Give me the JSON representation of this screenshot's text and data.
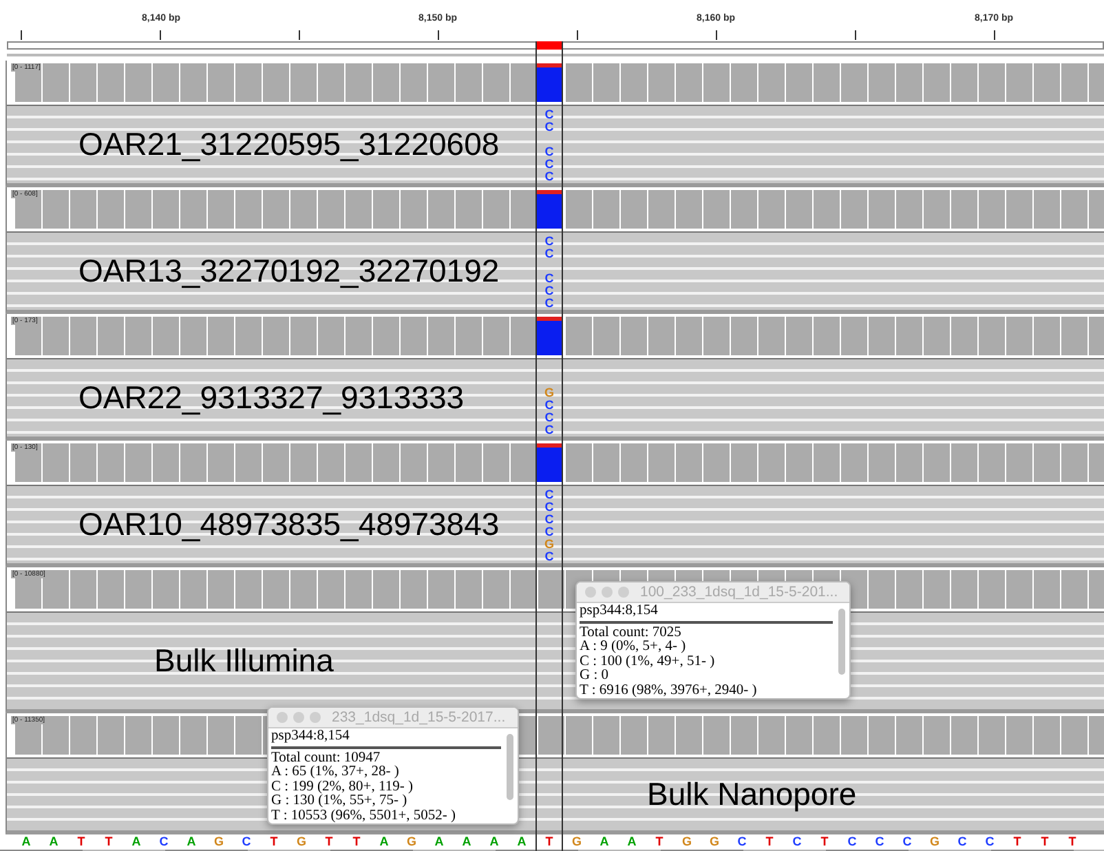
{
  "ruler": {
    "ticks": [
      "8,140 bp",
      "8,150 bp",
      "8,160 bp",
      "8,170 bp"
    ]
  },
  "tracks": [
    {
      "range": "[0 - 1117]",
      "label": "OAR21_31220595_31220608",
      "mismatches": [
        {
          "kind": "base",
          "base": "C",
          "color": "#1e3cff"
        },
        {
          "kind": "base",
          "base": "C",
          "color": "#1e3cff"
        },
        {
          "kind": "gap"
        },
        {
          "kind": "base",
          "base": "C",
          "color": "#1e3cff"
        },
        {
          "kind": "base",
          "base": "C",
          "color": "#1e3cff"
        },
        {
          "kind": "base",
          "base": "C",
          "color": "#1e3cff"
        }
      ]
    },
    {
      "range": "[0 - 608]",
      "label": "OAR13_32270192_32270192",
      "mismatches": [
        {
          "kind": "base",
          "base": "C",
          "color": "#1e3cff"
        },
        {
          "kind": "base",
          "base": "C",
          "color": "#1e3cff"
        },
        {
          "kind": "gap"
        },
        {
          "kind": "base",
          "base": "C",
          "color": "#1e3cff"
        },
        {
          "kind": "base",
          "base": "C",
          "color": "#1e3cff"
        },
        {
          "kind": "base",
          "base": "C",
          "color": "#1e3cff"
        }
      ]
    },
    {
      "range": "[0 - 173]",
      "label": "OAR22_9313327_9313333",
      "mismatches": [
        {
          "kind": "gap"
        },
        {
          "kind": "gap"
        },
        {
          "kind": "base",
          "base": "G",
          "color": "#d1861a"
        },
        {
          "kind": "base",
          "base": "C",
          "color": "#1e3cff"
        },
        {
          "kind": "base",
          "base": "C",
          "color": "#1e3cff"
        },
        {
          "kind": "base",
          "base": "C",
          "color": "#1e3cff"
        }
      ]
    },
    {
      "range": "[0 - 130]",
      "label": "OAR10_48973835_48973843",
      "mismatches": [
        {
          "kind": "base",
          "base": "C",
          "color": "#1e3cff"
        },
        {
          "kind": "base",
          "base": "C",
          "color": "#1e3cff"
        },
        {
          "kind": "base",
          "base": "C",
          "color": "#1e3cff"
        },
        {
          "kind": "base",
          "base": "C",
          "color": "#1e3cff"
        },
        {
          "kind": "base",
          "base": "G",
          "color": "#d1861a"
        },
        {
          "kind": "base",
          "base": "C",
          "color": "#1e3cff"
        }
      ]
    },
    {
      "range": "[0 - 10880]",
      "label": "Bulk Illumina"
    },
    {
      "range": "[0 - 11350]",
      "label": "Bulk Nanopore"
    }
  ],
  "popups": [
    {
      "title": "100_233_1dsq_1d_15-5-201...",
      "locus": "psp344:8,154",
      "lines": [
        "Total count: 7025",
        "A : 9 (0%, 5+, 4- )",
        "C : 100 (1%, 49+, 51- )",
        "G : 0",
        "T : 6916 (98%, 3976+, 2940- )"
      ]
    },
    {
      "title": "233_1dsq_1d_15-5-2017...",
      "locus": "psp344:8,154",
      "lines": [
        "Total count: 10947",
        "A : 65 (1%, 37+, 28- )",
        "C : 199 (2%, 80+, 119- )",
        "G : 130 (1%, 55+, 75- )",
        "T : 10553 (96%, 5501+, 5052- )"
      ]
    }
  ],
  "sequence": [
    {
      "base": "A",
      "color": "#00a000"
    },
    {
      "base": "A",
      "color": "#00a000"
    },
    {
      "base": "T",
      "color": "#e00000"
    },
    {
      "base": "T",
      "color": "#e00000"
    },
    {
      "base": "A",
      "color": "#00a000"
    },
    {
      "base": "C",
      "color": "#1e3cff"
    },
    {
      "base": "A",
      "color": "#00a000"
    },
    {
      "base": "G",
      "color": "#d1861a"
    },
    {
      "base": "C",
      "color": "#1e3cff"
    },
    {
      "base": "T",
      "color": "#e00000"
    },
    {
      "base": "G",
      "color": "#d1861a"
    },
    {
      "base": "T",
      "color": "#e00000"
    },
    {
      "base": "T",
      "color": "#e00000"
    },
    {
      "base": "A",
      "color": "#00a000"
    },
    {
      "base": "G",
      "color": "#d1861a"
    },
    {
      "base": "A",
      "color": "#00a000"
    },
    {
      "base": "A",
      "color": "#00a000"
    },
    {
      "base": "A",
      "color": "#00a000"
    },
    {
      "base": "A",
      "color": "#00a000"
    },
    {
      "base": "T",
      "color": "#e00000"
    },
    {
      "base": "G",
      "color": "#d1861a"
    },
    {
      "base": "A",
      "color": "#00a000"
    },
    {
      "base": "A",
      "color": "#00a000"
    },
    {
      "base": "T",
      "color": "#e00000"
    },
    {
      "base": "G",
      "color": "#d1861a"
    },
    {
      "base": "G",
      "color": "#d1861a"
    },
    {
      "base": "C",
      "color": "#1e3cff"
    },
    {
      "base": "T",
      "color": "#e00000"
    },
    {
      "base": "C",
      "color": "#1e3cff"
    },
    {
      "base": "T",
      "color": "#e00000"
    },
    {
      "base": "C",
      "color": "#1e3cff"
    },
    {
      "base": "C",
      "color": "#1e3cff"
    },
    {
      "base": "C",
      "color": "#1e3cff"
    },
    {
      "base": "G",
      "color": "#d1861a"
    },
    {
      "base": "C",
      "color": "#1e3cff"
    },
    {
      "base": "C",
      "color": "#1e3cff"
    },
    {
      "base": "T",
      "color": "#e00000"
    },
    {
      "base": "T",
      "color": "#e00000"
    },
    {
      "base": "T",
      "color": "#e00000"
    }
  ]
}
